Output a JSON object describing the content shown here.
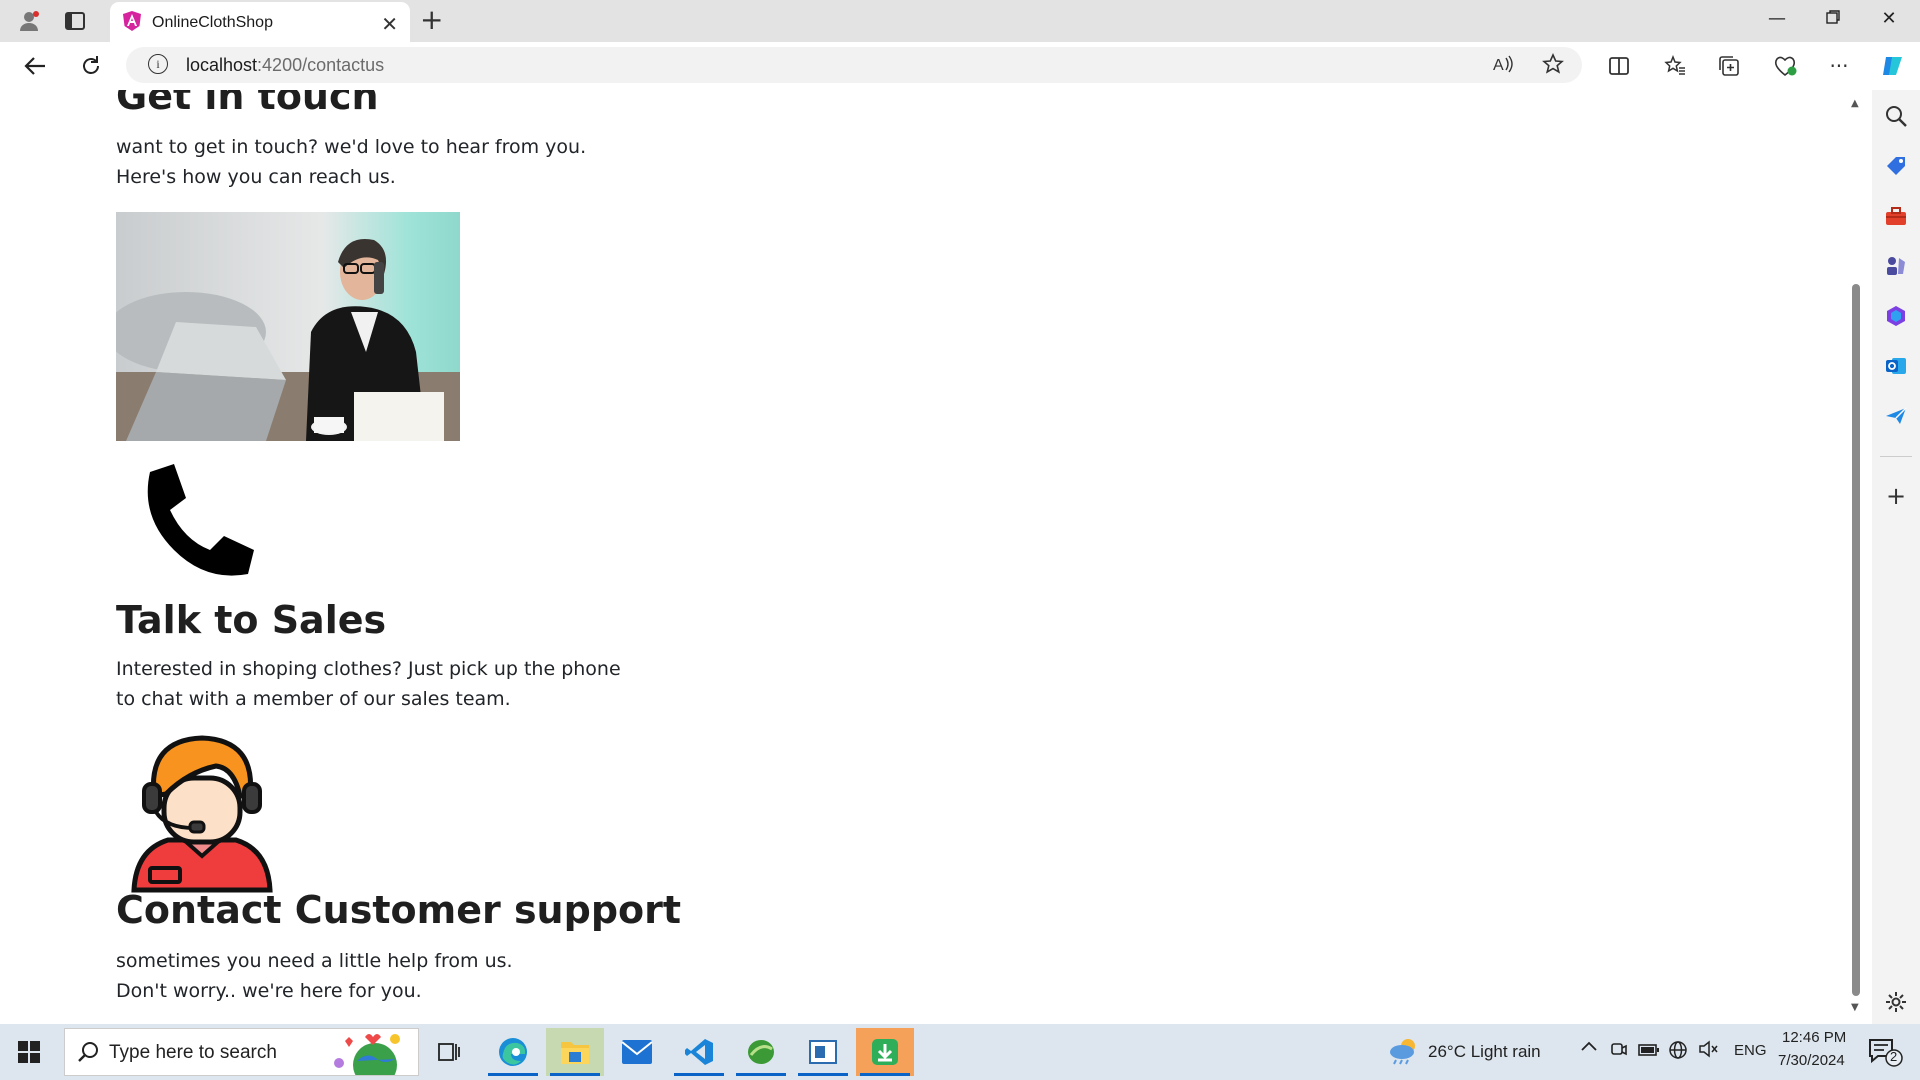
{
  "browser": {
    "tab_title": "OnlineClothShop",
    "url_host": "localhost",
    "url_path": ":4200/contactus",
    "window_controls": [
      "minimize-icon",
      "restore-icon",
      "close-icon"
    ]
  },
  "page": {
    "heading_main": "Get in touch",
    "intro_line1": "want to get in touch? we'd love to hear from you.",
    "intro_line2": "Here's how you can reach us.",
    "sales_heading": "Talk to Sales",
    "sales_line1": "Interested in shoping clothes? Just pick up the phone",
    "sales_line2": "to chat with a member of our sales team.",
    "support_heading": "Contact Customer support",
    "support_line1": "sometimes you need a little help from us.",
    "support_line2": "Don't worry.. we're here for you."
  },
  "sidebar": {
    "icons": [
      "search-icon",
      "tag-icon",
      "toolbox-icon",
      "chess-icon",
      "office-icon",
      "outlook-icon",
      "send-icon",
      "add-icon",
      "settings-icon"
    ]
  },
  "taskbar": {
    "search_placeholder": "Type here to search",
    "weather": "26°C  Light rain",
    "language": "ENG",
    "time": "12:46 PM",
    "date": "7/30/2024",
    "notifications": "2"
  },
  "colors": {
    "accent": "#0a64c8",
    "heading": "#1f1f1f",
    "support_agent": "#ef3d3d",
    "support_hair": "#f7931e"
  }
}
